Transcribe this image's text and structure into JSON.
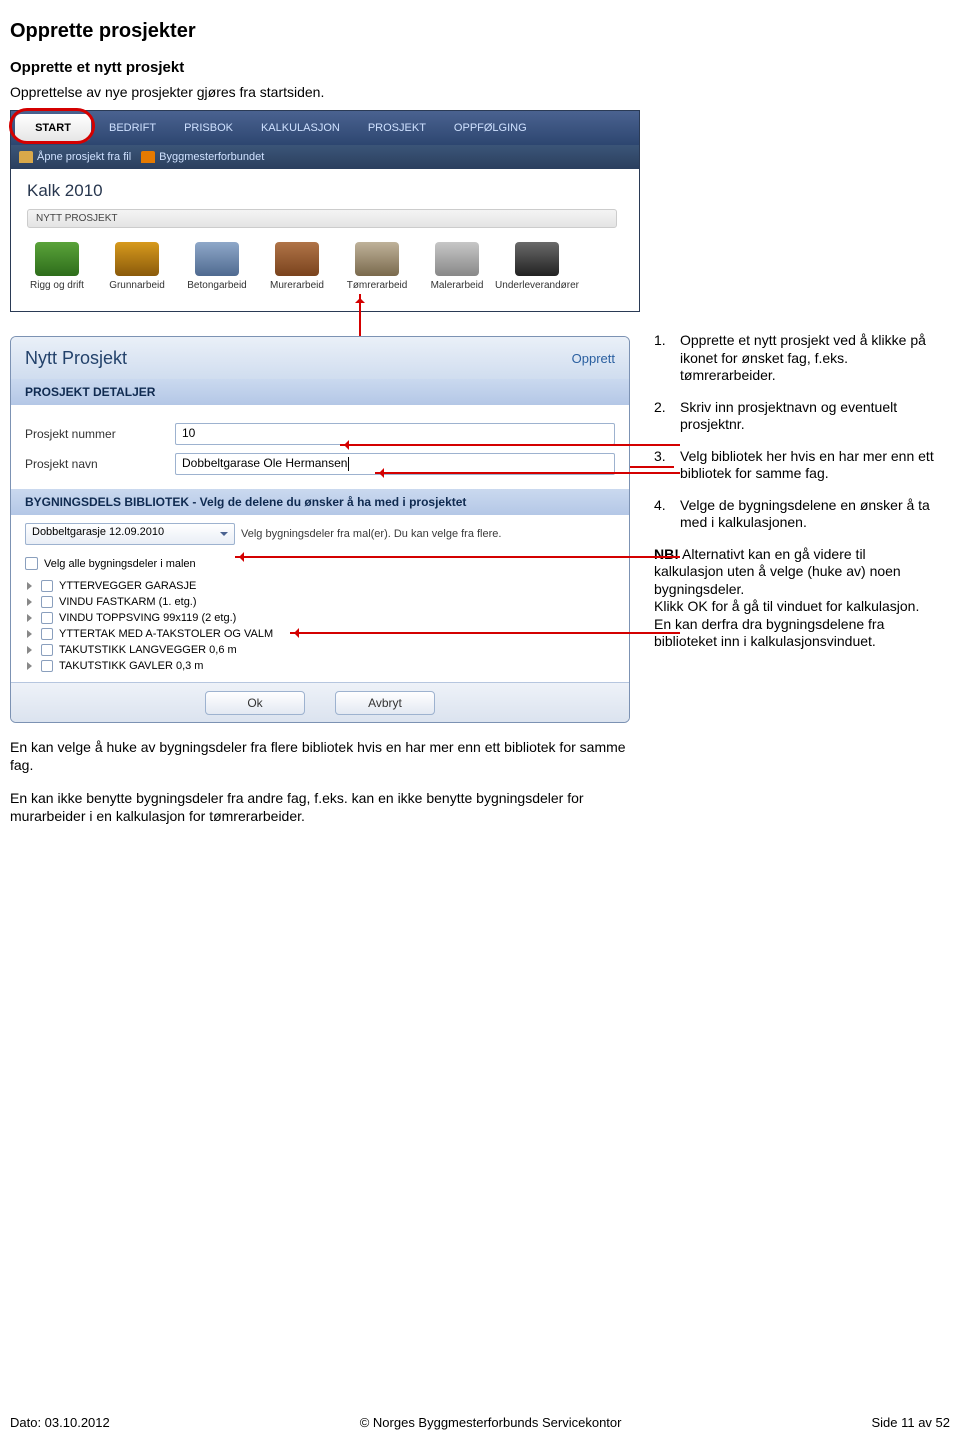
{
  "headings": {
    "h1": "Opprette prosjekter",
    "h2": "Opprette et nytt prosjekt"
  },
  "intro": "Opprettelse av nye prosjekter gjøres fra startsiden.",
  "app1": {
    "tabs": [
      "START",
      "BEDRIFT",
      "PRISBOK",
      "KALKULASJON",
      "PROSJEKT",
      "OPPFØLGING"
    ],
    "toolbar": {
      "open": "Åpne prosjekt fra fil",
      "org": "Byggmesterforbundet"
    },
    "title": "Kalk 2010",
    "section_label": "NYTT PROSJEKT",
    "icons": [
      "Rigg og drift",
      "Grunnarbeid",
      "Betongarbeid",
      "Murerarbeid",
      "Tømrerarbeid",
      "Malerarbeid",
      "Underleverandører"
    ]
  },
  "dialog": {
    "title": "Nytt Prosjekt",
    "create": "Opprett",
    "section1": "PROSJEKT DETALJER",
    "field_num_label": "Prosjekt nummer",
    "field_num_value": "10",
    "field_name_label": "Prosjekt navn",
    "field_name_value": "Dobbeltgarase Ole Hermansen",
    "section2": "BYGNINGSDELS BIBLIOTEK - Velg de delene du ønsker å ha med i prosjektet",
    "select_value": "Dobbeltgarasje 12.09.2010",
    "select_hint": "Velg bygningsdeler fra mal(er). Du kan velge fra flere.",
    "check_all": "Velg alle bygningsdeler i malen",
    "tree": [
      "YTTERVEGGER GARASJE",
      "VINDU FASTKARM (1. etg.)",
      "VINDU TOPPSVING 99x119 (2 etg.)",
      "YTTERTAK MED A-TAKSTOLER OG VALM",
      "TAKUTSTIKK LANGVEGGER 0,6 m",
      "TAKUTSTIKK GAVLER 0,3 m"
    ],
    "ok": "Ok",
    "cancel": "Avbryt"
  },
  "right_list": [
    "Opprette et nytt prosjekt ved å klikke på ikonet for ønsket fag, f.eks. tømrerarbeider.",
    "Skriv inn prosjektnavn og eventuelt prosjektnr.",
    "Velg bibliotek her hvis en har mer enn ett bibliotek for samme fag.",
    "Velge de bygningsdelene en ønsker å ta med i kalkulasjonen."
  ],
  "right_nb_label": "NB!",
  "right_nb": " Alternativt kan en gå videre til kalkulasjon uten å velge (huke av) noen bygningsdeler.\nKlikk OK for å gå til vinduet for kalkulasjon. En kan derfra dra bygningsdelene fra biblioteket inn i kalkulasjonsvinduet.",
  "after1": "En kan velge å huke av bygningsdeler fra flere bibliotek hvis en har mer enn ett bibliotek for samme fag.",
  "after2": "En kan ikke benytte bygningsdeler fra andre fag, f.eks. kan en ikke benytte bygningsdeler for murarbeider i en kalkulasjon for tømrerarbeider.",
  "footer": {
    "left": "Dato: 03.10.2012",
    "center": "© Norges Byggmesterforbunds Servicekontor",
    "right": "Side 11 av 52"
  }
}
